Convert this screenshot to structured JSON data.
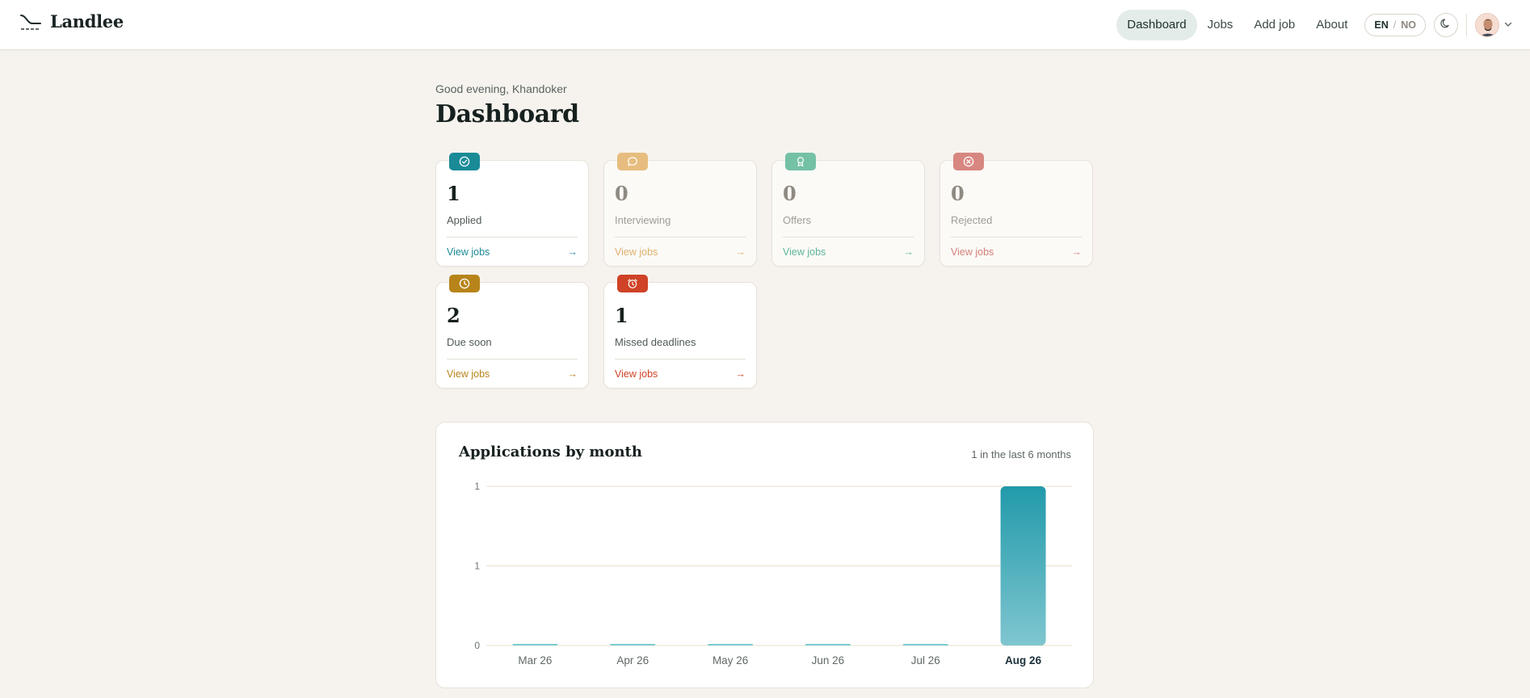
{
  "brand": {
    "name": "Landlee"
  },
  "nav": {
    "items": [
      {
        "label": "Dashboard",
        "active": true
      },
      {
        "label": "Jobs",
        "active": false
      },
      {
        "label": "Add job",
        "active": false
      },
      {
        "label": "About",
        "active": false
      }
    ],
    "lang": {
      "primary": "EN",
      "separator": "/",
      "secondary": "NO"
    },
    "theme_icon": "moon-icon",
    "user_icon": "avatar",
    "chevron_icon": "chevron-down-icon"
  },
  "greeting": "Good evening, Khandoker",
  "title": "Dashboard",
  "cards": [
    {
      "count": "1",
      "label": "Applied",
      "link": "View jobs",
      "arrow": "→",
      "color": "#1a8a97",
      "icon": "check-circle-icon",
      "muted": false
    },
    {
      "count": "0",
      "label": "Interviewing",
      "link": "View jobs",
      "arrow": "→",
      "color": "#dfb06b",
      "icon": "chat-bubble-icon",
      "muted": true
    },
    {
      "count": "0",
      "label": "Offers",
      "link": "View jobs",
      "arrow": "→",
      "color": "#5fb59a",
      "icon": "award-icon",
      "muted": true
    },
    {
      "count": "0",
      "label": "Rejected",
      "link": "View jobs",
      "arrow": "→",
      "color": "#d4807a",
      "icon": "x-circle-icon",
      "muted": true
    },
    {
      "count": "2",
      "label": "Due soon",
      "link": "View jobs",
      "arrow": "→",
      "color": "#b7841a",
      "icon": "clock-icon",
      "muted": false
    },
    {
      "count": "1",
      "label": "Missed deadlines",
      "link": "View jobs",
      "arrow": "→",
      "color": "#cf4225",
      "icon": "alarm-clock-icon",
      "muted": false
    }
  ],
  "chart_panel": {
    "title": "Applications by month",
    "summary": "1 in the last 6 months"
  },
  "chart_data": {
    "type": "bar",
    "title": "Applications by month",
    "categories": [
      "Mar 26",
      "Apr 26",
      "May 26",
      "Jun 26",
      "Jul 26",
      "Aug 26"
    ],
    "values": [
      0,
      0,
      0,
      0,
      0,
      1
    ],
    "highlight_category": "Aug 26",
    "ytick_labels": [
      "0",
      "1",
      "1"
    ],
    "ytick_values": [
      0,
      0.5,
      1
    ],
    "ylim": [
      0,
      1
    ],
    "grid": true,
    "xlabel": "",
    "ylabel": "",
    "bar_color": "#229aaa"
  }
}
